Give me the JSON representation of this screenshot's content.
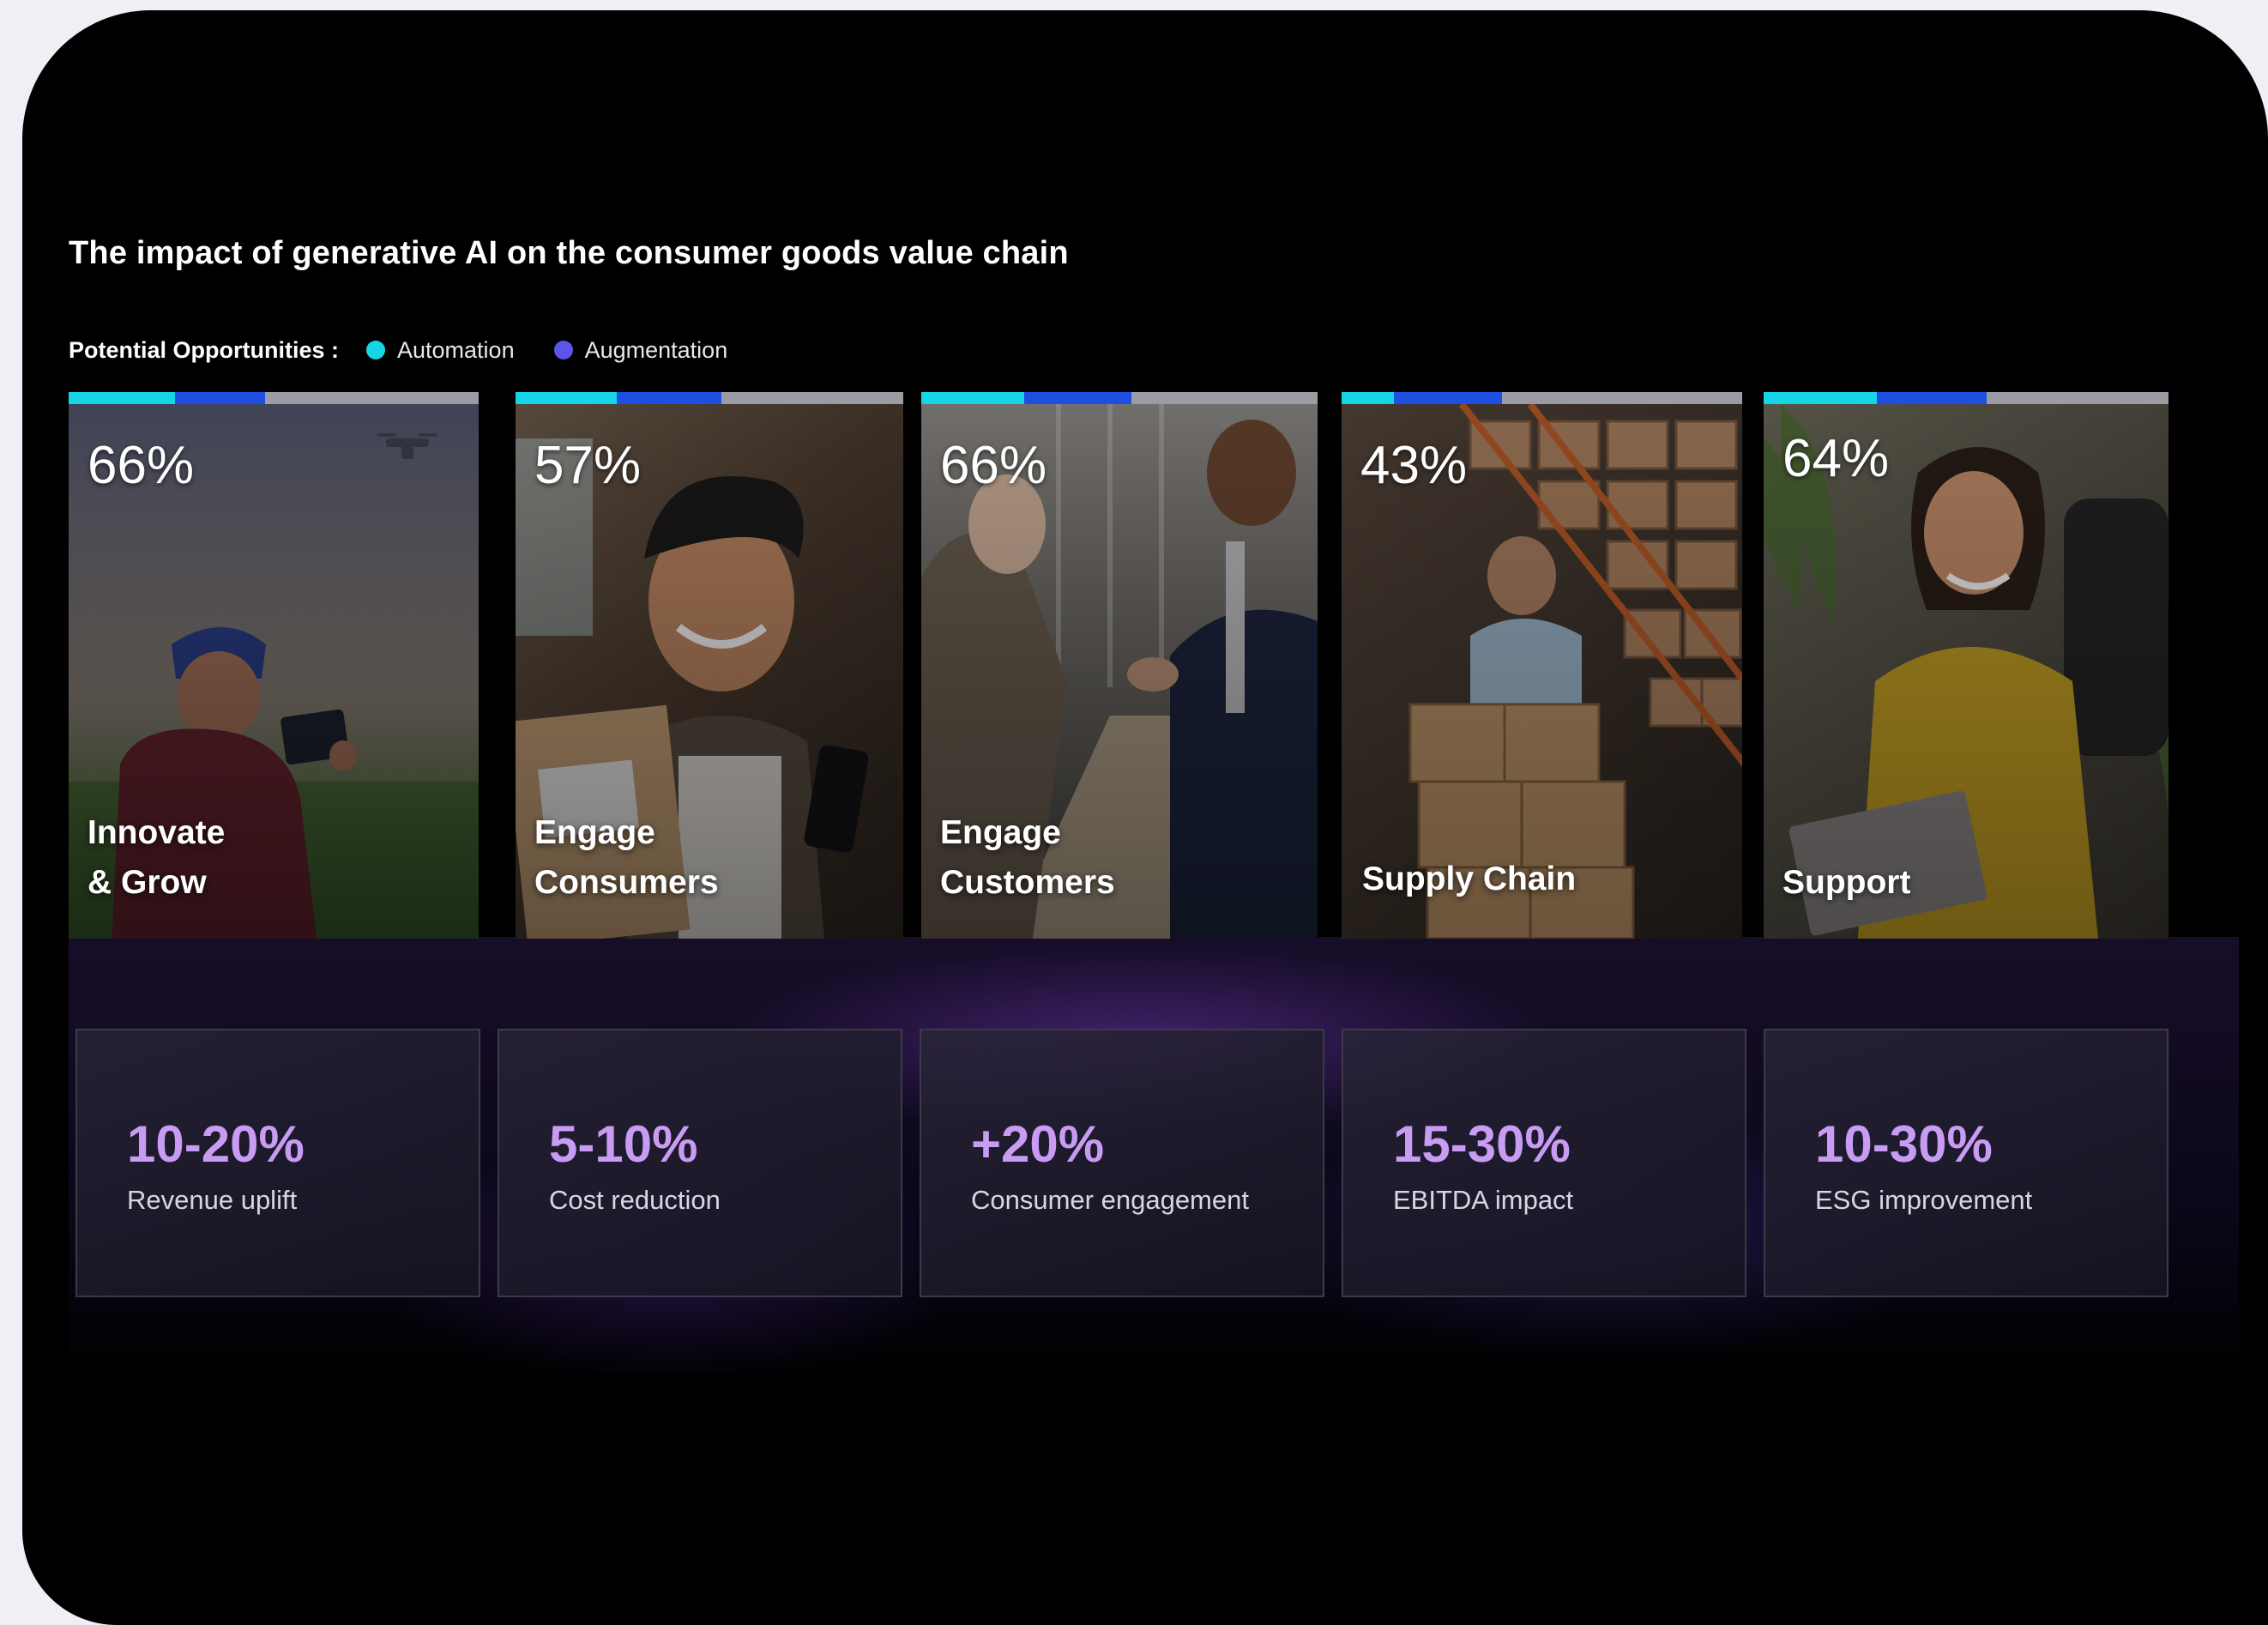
{
  "header": {
    "title": "The impact of generative AI on the consumer goods value chain"
  },
  "legend": {
    "heading": "Potential Opportunities :",
    "items": [
      {
        "label": "Automation",
        "color": "#16d6e6"
      },
      {
        "label": "Augmentation",
        "color": "#5b55e8"
      }
    ]
  },
  "colors": {
    "automation": "#16d6e6",
    "augmentation": "#1f4fe0",
    "bar_remainder": "#9b9ca3",
    "stat_value": "#c89cf3"
  },
  "cards": [
    {
      "percent": "66%",
      "label_line1": "Innovate",
      "label_line2": "& Grow",
      "automation_share": 0.26,
      "augmentation_share": 0.22
    },
    {
      "percent": "57%",
      "label_line1": "Engage",
      "label_line2": "Consumers",
      "automation_share": 0.26,
      "augmentation_share": 0.27
    },
    {
      "percent": "66%",
      "label_line1": "Engage",
      "label_line2": "Customers",
      "automation_share": 0.26,
      "augmentation_share": 0.27
    },
    {
      "percent": "43%",
      "label_line1": "",
      "label_line2": "Supply Chain",
      "automation_share": 0.13,
      "augmentation_share": 0.27
    },
    {
      "percent": "64%",
      "label_line1": "",
      "label_line2": "Support",
      "automation_share": 0.28,
      "augmentation_share": 0.27
    }
  ],
  "stats": [
    {
      "value": "10-20%",
      "label": "Revenue uplift"
    },
    {
      "value": "5-10%",
      "label": "Cost reduction"
    },
    {
      "value": "+20%",
      "label": "Consumer engagement"
    },
    {
      "value": "15-30%",
      "label": "EBITDA impact"
    },
    {
      "value": "10-30%",
      "label": "ESG improvement"
    }
  ]
}
